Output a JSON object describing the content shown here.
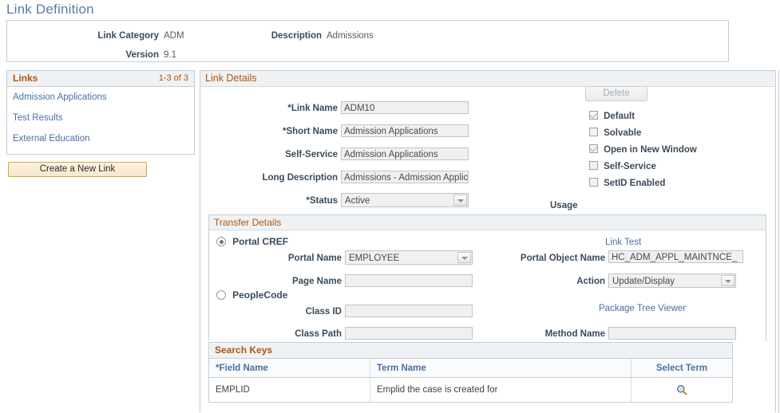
{
  "page": {
    "title": "Link Definition"
  },
  "summary": {
    "link_category_label": "Link Category",
    "link_category_value": "ADM",
    "description_label": "Description",
    "description_value": "Admissions",
    "version_label": "Version",
    "version_value": "9.1"
  },
  "links_panel": {
    "header": "Links",
    "count": "1-3 of 3",
    "items": [
      {
        "label": "Admission Applications"
      },
      {
        "label": "Test Results"
      },
      {
        "label": "External Education"
      }
    ],
    "create_button": "Create a New Link"
  },
  "link_details": {
    "header": "Link Details",
    "delete_button": "Delete",
    "fields": [
      {
        "label": "*Link Name",
        "value": "ADM10"
      },
      {
        "label": "*Short Name",
        "value": "Admission Applications"
      },
      {
        "label": "Self-Service",
        "value": "Admission Applications"
      },
      {
        "label": "Long Description",
        "value": "Admissions - Admission Applications"
      },
      {
        "label": "*Status",
        "value": "Active"
      }
    ],
    "checkboxes": [
      {
        "label": "Default",
        "checked": true
      },
      {
        "label": "Solvable",
        "checked": false
      },
      {
        "label": "Open in New Window",
        "checked": true
      },
      {
        "label": "Self-Service",
        "checked": false
      },
      {
        "label": "SetID Enabled",
        "checked": false
      }
    ],
    "usage_label": "Usage"
  },
  "transfer_details": {
    "header": "Transfer Details",
    "portal_cref_option": "Portal CREF",
    "peoplecode_option": "PeopleCode",
    "selected_option": "Portal CREF",
    "portal_name_label": "Portal Name",
    "portal_name_value": "EMPLOYEE",
    "page_name_label": "Page Name",
    "page_name_value": "",
    "class_id_label": "Class ID",
    "class_id_value": "",
    "class_path_label": "Class Path",
    "class_path_value": "",
    "link_test_link": "Link Test",
    "portal_object_name_label": "Portal Object Name",
    "portal_object_name_value": "HC_ADM_APPL_MAINTNCE_",
    "action_label": "Action",
    "action_value": "Update/Display",
    "package_tree_viewer_link": "Package Tree Viewer",
    "method_name_label": "Method Name",
    "method_name_value": ""
  },
  "search_keys": {
    "header": "Search Keys",
    "columns": [
      "*Field Name",
      "Term Name",
      "Select Term"
    ],
    "rows": [
      {
        "field_name": "EMPLID",
        "term_name": "Emplid the case is created for",
        "select_term_icon": "magnifier-icon"
      }
    ]
  },
  "colors": {
    "page_title": "#5a7ba6",
    "section_heading": "#b35309",
    "link": "#4a6fa5",
    "label": "#3b4a5a",
    "panel_header_bg": "#eef2f4",
    "border": "#c8cdd3",
    "field_bg": "#f0f0f0",
    "create_button_border": "#d9a441"
  }
}
